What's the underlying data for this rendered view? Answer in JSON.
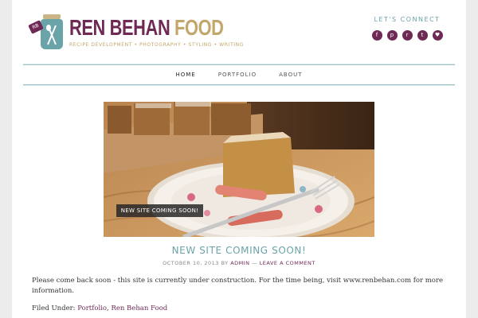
{
  "header": {
    "logo": {
      "title_part1": "REN BEHAN",
      "title_part2": "FOOD",
      "tagline": "RECIPE DEVELOPMENT • PHOTOGRAPHY • STYLING • WRITING",
      "tag_text": "RB"
    },
    "connect_label": "LET'S CONNECT",
    "social_icons": [
      {
        "name": "facebook-icon",
        "glyph": "f"
      },
      {
        "name": "pinterest-icon",
        "glyph": "p"
      },
      {
        "name": "rss-icon",
        "glyph": "r"
      },
      {
        "name": "twitter-icon",
        "glyph": "t"
      },
      {
        "name": "heart-icon",
        "glyph": "♥"
      }
    ]
  },
  "nav": {
    "items": [
      "HOME",
      "PORTFOLIO",
      "ABOUT"
    ],
    "active": "HOME"
  },
  "hero": {
    "caption": "NEW SITE COMING SOON!"
  },
  "post": {
    "title": "NEW SITE COMING SOON!",
    "date": "OCTOBER 10, 2013",
    "by_label": "BY",
    "author": "ADMIN",
    "separator": "—",
    "comment_link": "LEAVE A COMMENT",
    "body": "Please come back soon - this site is currently under construction. For the time being, visit www.renbehan.com for more information.",
    "filed_label": "Filed Under:",
    "categories": [
      "Portfolio",
      "Ren Behan Food"
    ]
  },
  "colors": {
    "plum": "#6e2a55",
    "teal": "#6aa3a8",
    "gold": "#c3a66a"
  }
}
